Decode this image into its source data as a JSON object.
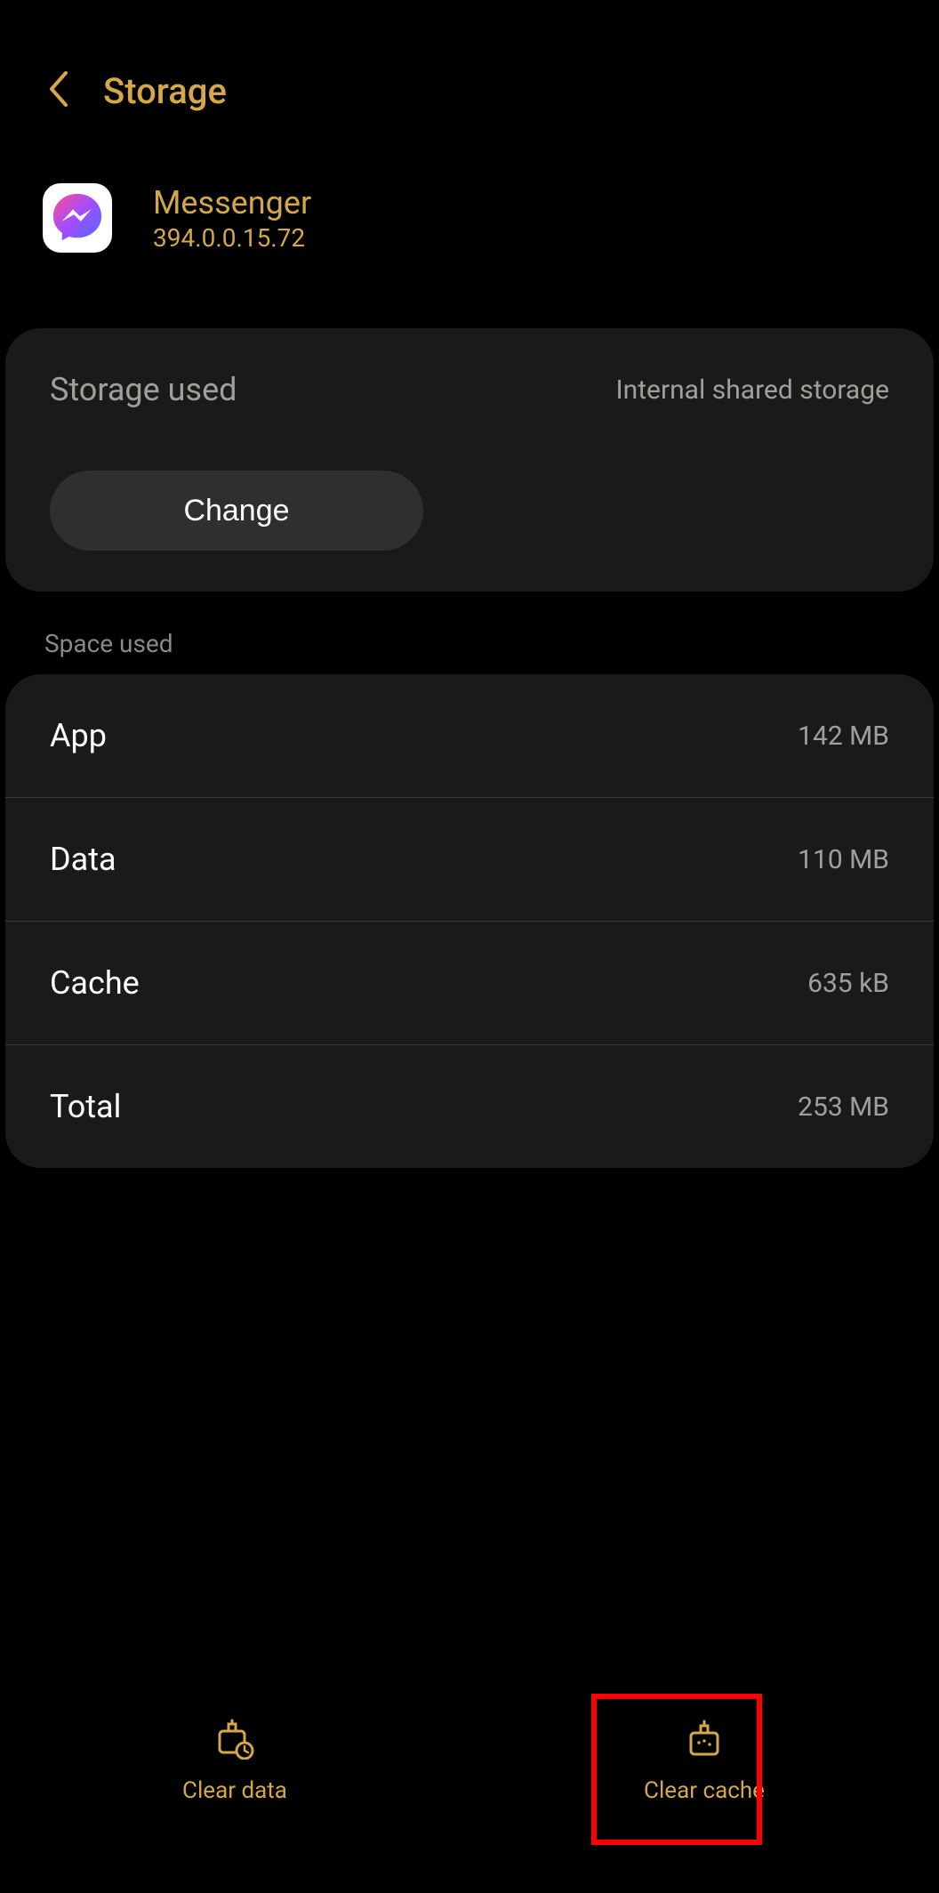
{
  "header": {
    "title": "Storage"
  },
  "app": {
    "name": "Messenger",
    "version": "394.0.0.15.72"
  },
  "storage_card": {
    "label": "Storage used",
    "location": "Internal shared storage",
    "change_label": "Change"
  },
  "space_section_label": "Space used",
  "space": [
    {
      "label": "App",
      "value": "142 MB"
    },
    {
      "label": "Data",
      "value": "110 MB"
    },
    {
      "label": "Cache",
      "value": "635 kB"
    },
    {
      "label": "Total",
      "value": "253 MB"
    }
  ],
  "bottom": {
    "clear_data": "Clear data",
    "clear_cache": "Clear cache"
  }
}
